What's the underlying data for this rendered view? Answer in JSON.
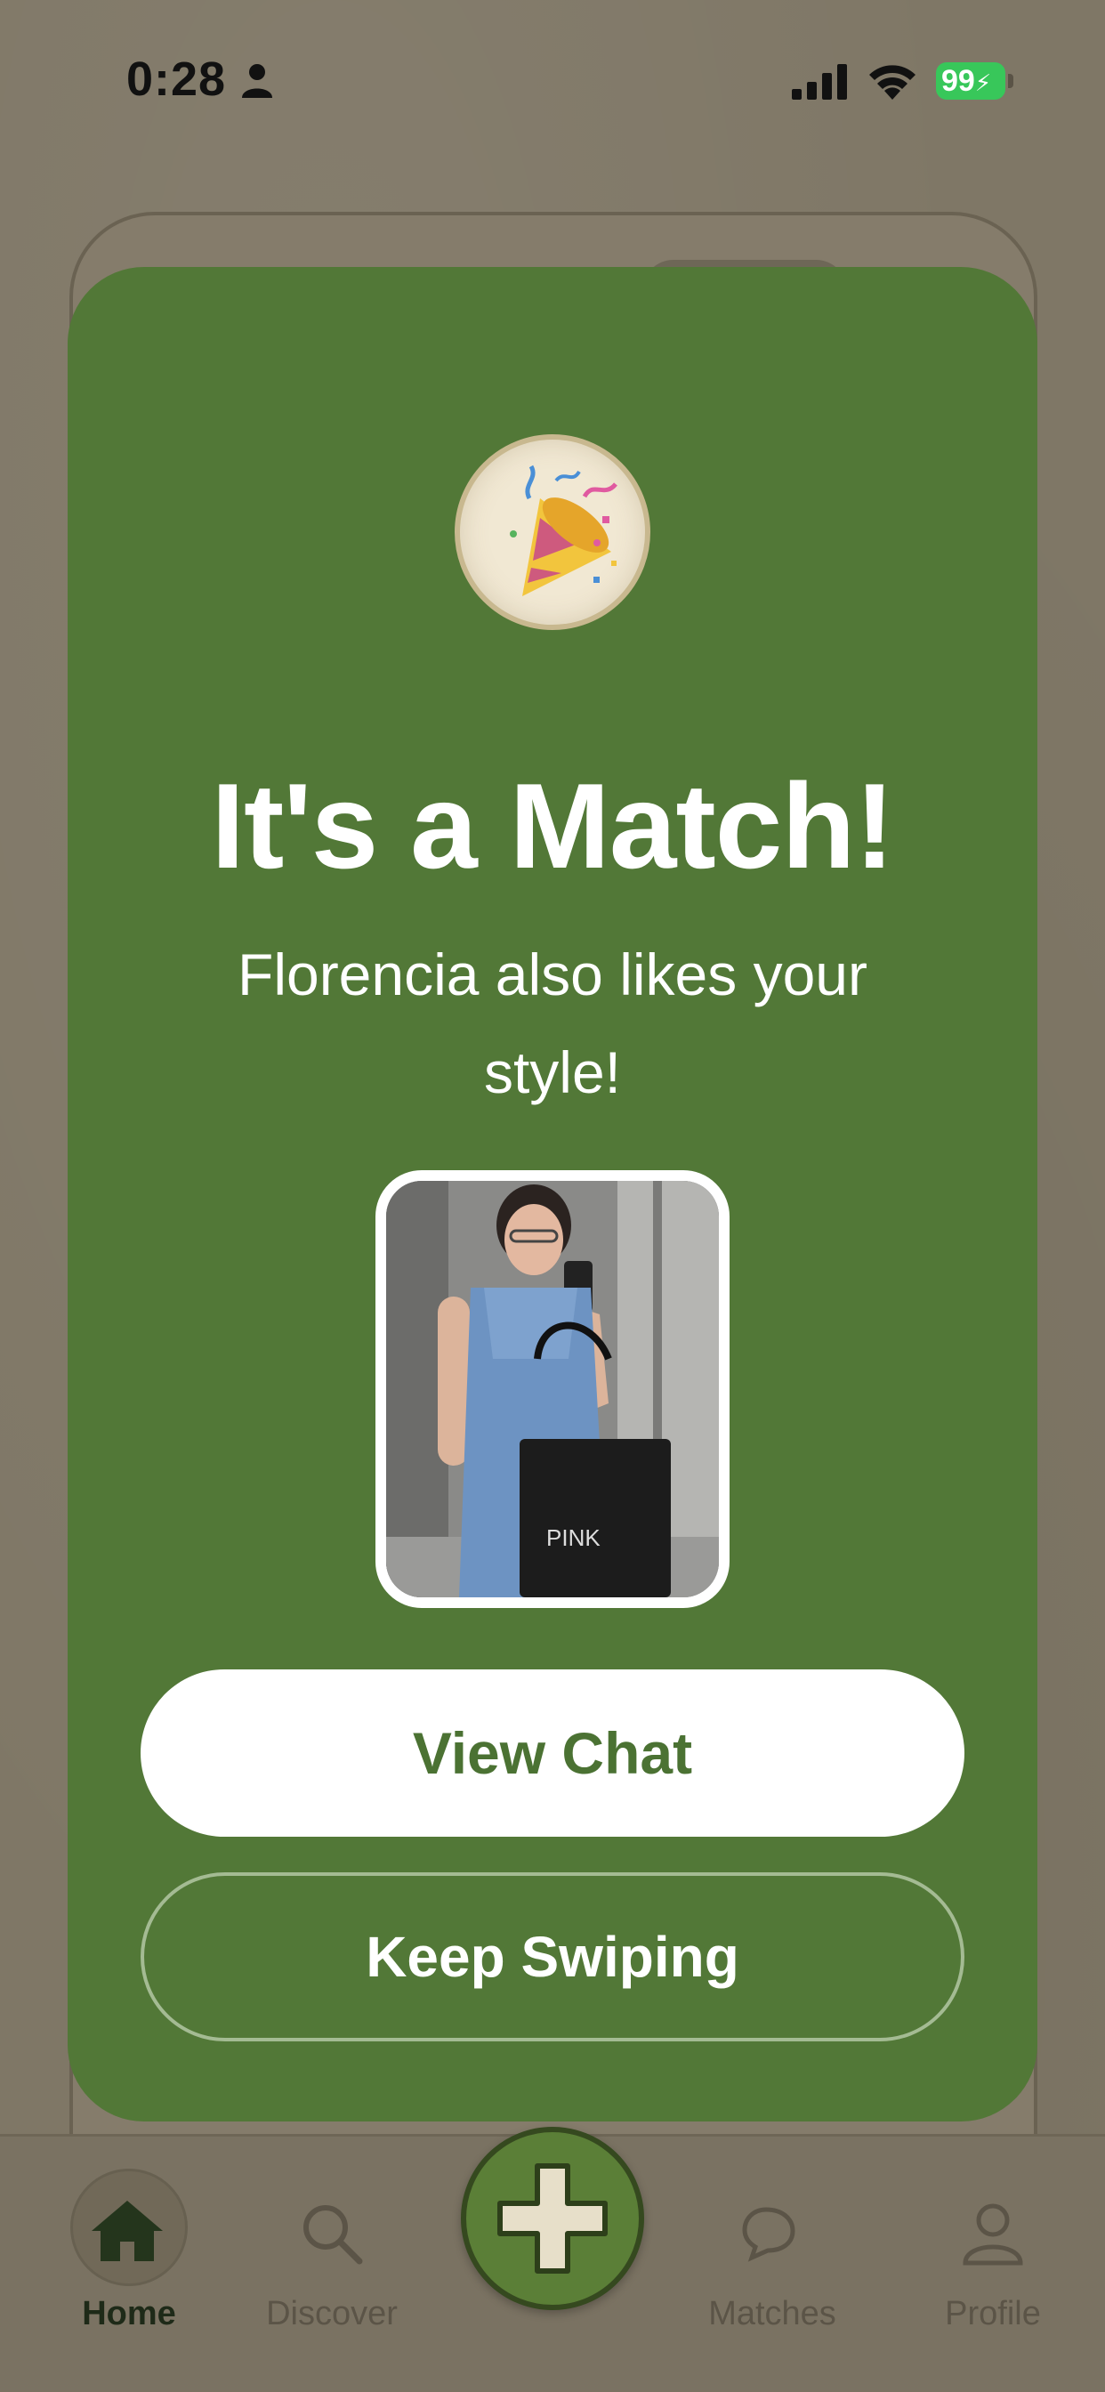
{
  "status_bar": {
    "time": "0:28",
    "battery": "99"
  },
  "modal": {
    "icon": "party-popper-icon",
    "title": "It's a Match!",
    "subtitle": "Florencia also likes your style!",
    "view_chat_label": "View Chat",
    "keep_swiping_label": "Keep Swiping"
  },
  "tabbar": {
    "home": "Home",
    "discover": "Discover",
    "matches": "Matches",
    "profile": "Profile"
  },
  "colors": {
    "modal_green": "#527837",
    "button_text_green": "#4b7233",
    "battery_green": "#38c75a"
  }
}
